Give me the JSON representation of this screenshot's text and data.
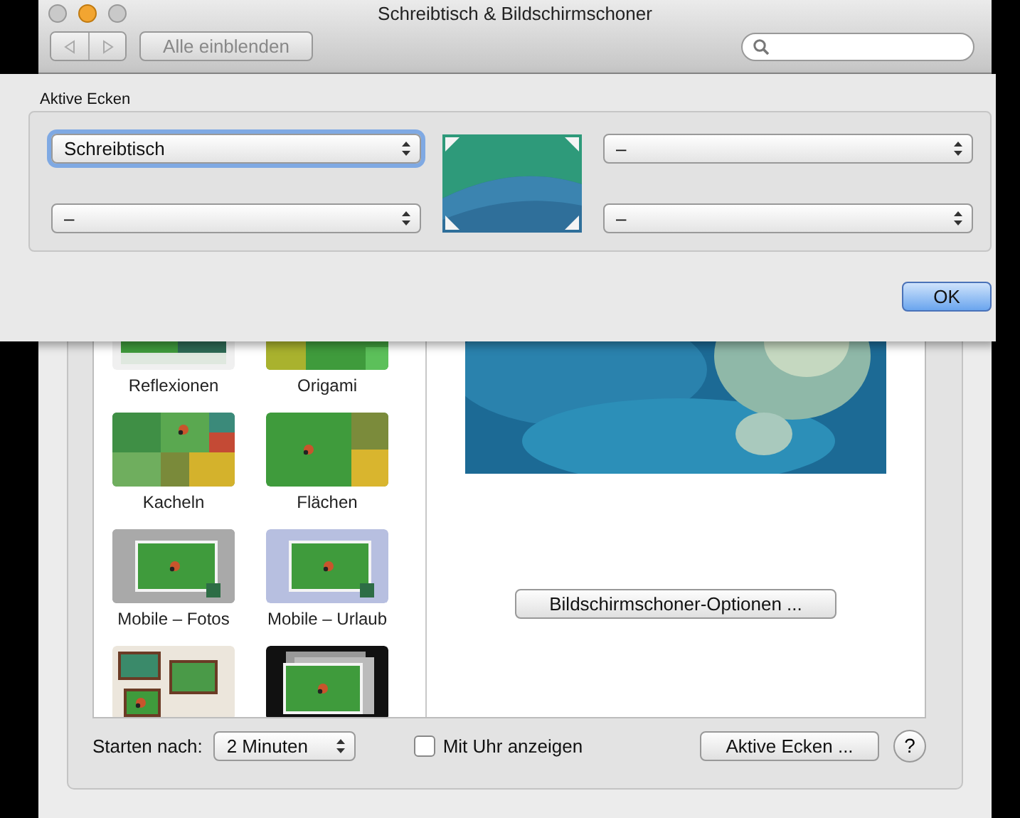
{
  "window": {
    "title": "Schreibtisch & Bildschirmschoner"
  },
  "toolbar": {
    "show_all_button": "Alle einblenden"
  },
  "sheet": {
    "title": "Aktive Ecken",
    "corners": [
      {
        "value": "Schreibtisch",
        "focused": true
      },
      {
        "value": "–",
        "focused": false
      },
      {
        "value": "–",
        "focused": false
      },
      {
        "value": "–",
        "focused": false
      }
    ],
    "ok_button": "OK"
  },
  "screensavers": [
    {
      "kind": "picture",
      "label": "Reflexionen"
    },
    {
      "kind": "picture",
      "label": "Origami"
    },
    {
      "kind": "picture",
      "label": "Kacheln"
    },
    {
      "kind": "picture",
      "label": "Flächen"
    },
    {
      "kind": "picture",
      "label": "Mobile – Fotos"
    },
    {
      "kind": "picture",
      "label": "Mobile – Urlaub"
    },
    {
      "kind": "picture"
    },
    {
      "kind": "picture"
    }
  ],
  "options_button": "Bildschirmschoner-Optionen ...",
  "footer": {
    "start_label": "Starten nach:",
    "start_value": "2 Minuten",
    "clock": {
      "label": "Mit Uhr anzeigen",
      "checked": false
    },
    "hot_corners_button": "Aktive Ecken ...",
    "help_button": "?"
  }
}
